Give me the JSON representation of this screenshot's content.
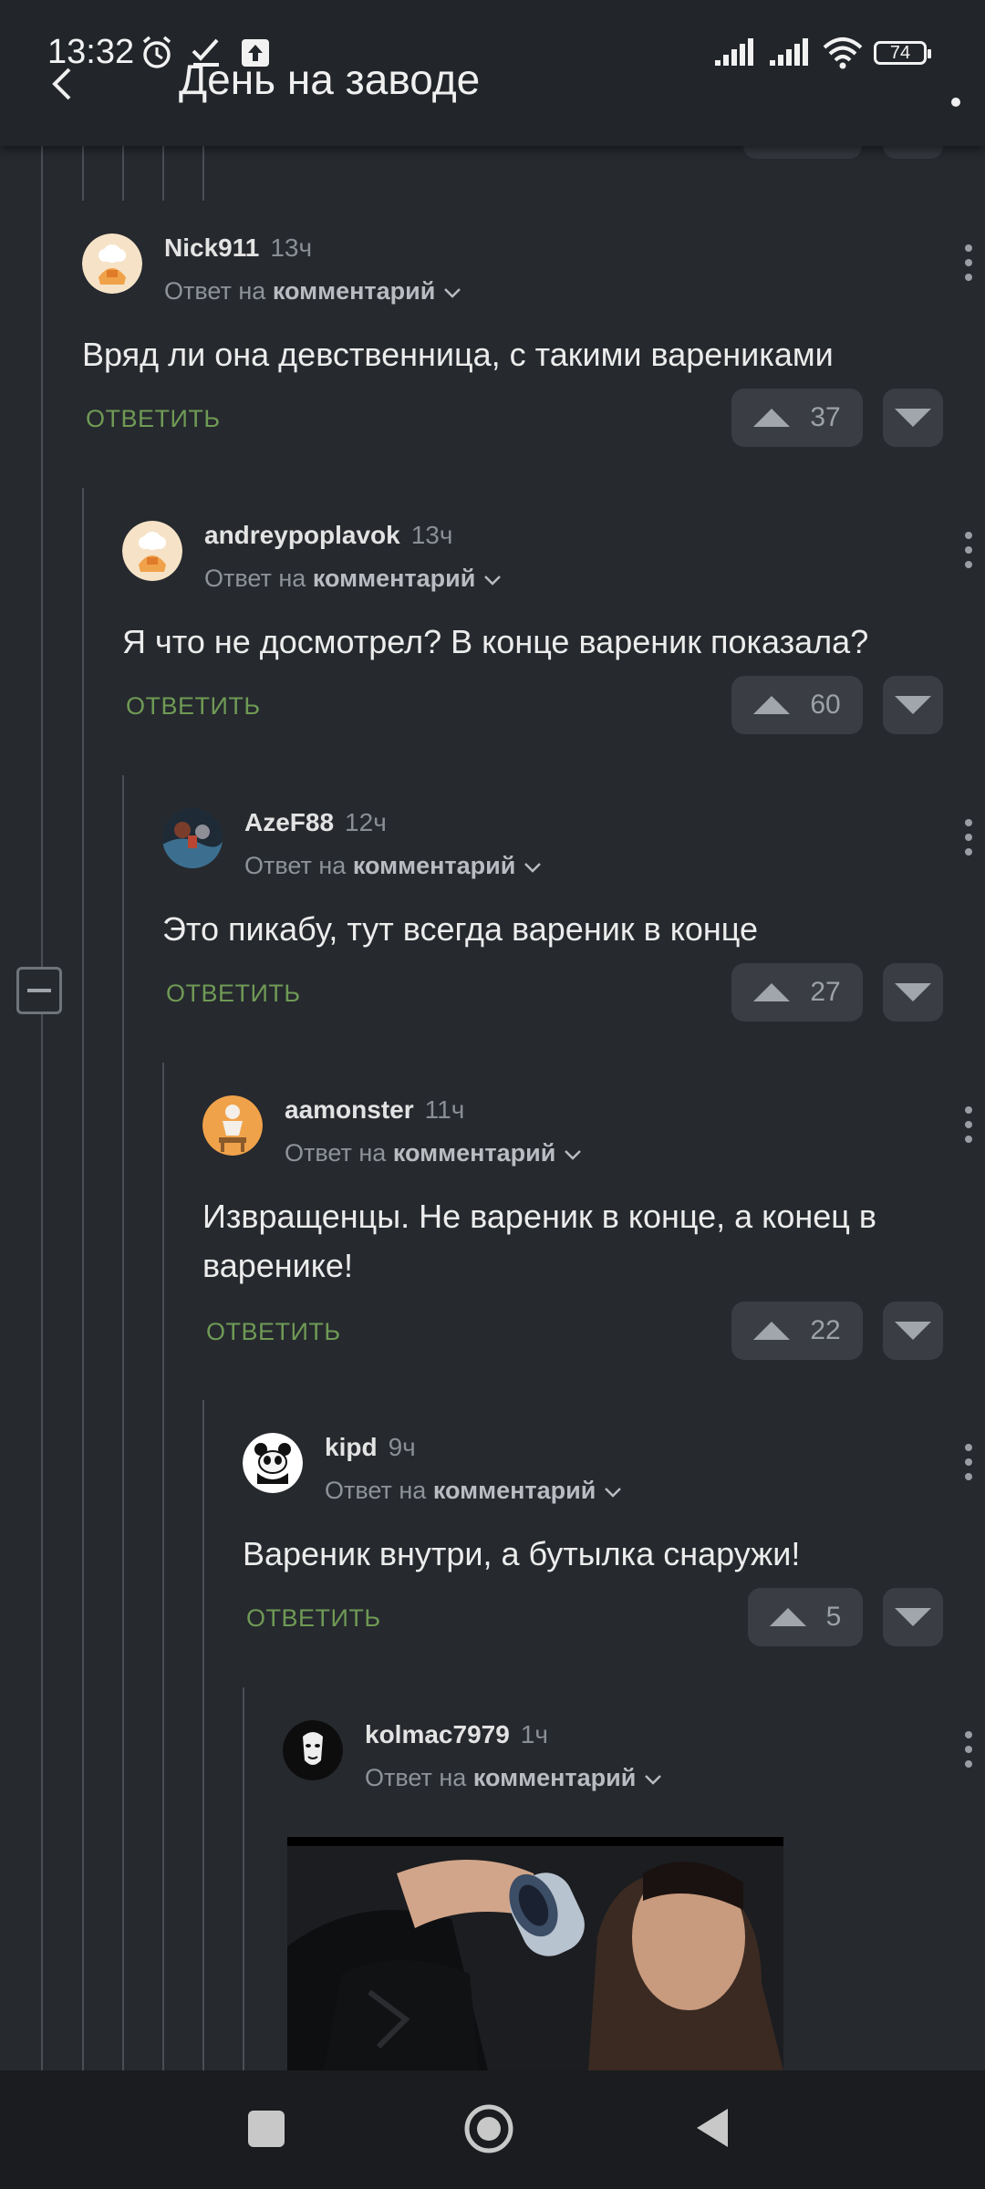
{
  "status_bar": {
    "time": "13:32",
    "battery": "74"
  },
  "header": {
    "title": "День на заводе"
  },
  "colors": {
    "background": "#26292e",
    "reply_green": "#6f9a55",
    "vote_bg": "#3a3e44"
  },
  "comments": [
    {
      "author": "Nick911",
      "time": "13ч",
      "reply_prefix": "Ответ на",
      "reply_target": "комментарий",
      "text": "Вряд ли она девственница, с такими варениками",
      "reply_label": "ОТВЕТИТЬ",
      "votes": "37",
      "avatar": "chef-avatar"
    },
    {
      "author": "andreypoplavok",
      "time": "13ч",
      "reply_prefix": "Ответ на",
      "reply_target": "комментарий",
      "text": "Я что не досмотрел? В конце вареник показала?",
      "reply_label": "ОТВЕТИТЬ",
      "votes": "60",
      "avatar": "chef-avatar"
    },
    {
      "author": "AzeF88",
      "time": "12ч",
      "reply_prefix": "Ответ на",
      "reply_target": "комментарий",
      "text": "Это пикабу, тут всегда вареник в конце",
      "reply_label": "ОТВЕТИТЬ",
      "votes": "27",
      "avatar": "photo-avatar"
    },
    {
      "author": "aamonster",
      "time": "11ч",
      "reply_prefix": "Ответ на",
      "reply_target": "комментарий",
      "text": "Извращенцы. Не вареник в конце, а конец в варенике!",
      "reply_label": "ОТВЕТИТЬ",
      "votes": "22",
      "avatar": "statue-avatar"
    },
    {
      "author": "kipd",
      "time": "9ч",
      "reply_prefix": "Ответ на",
      "reply_target": "комментарий",
      "text": "Вареник внутри, а бутылка снаружи!",
      "reply_label": "ОТВЕТИТЬ",
      "votes": "5",
      "avatar": "panda-avatar"
    },
    {
      "author": "kolmac7979",
      "time": "1ч",
      "reply_prefix": "Ответ на",
      "reply_target": "комментарий",
      "avatar": "mask-avatar"
    }
  ]
}
